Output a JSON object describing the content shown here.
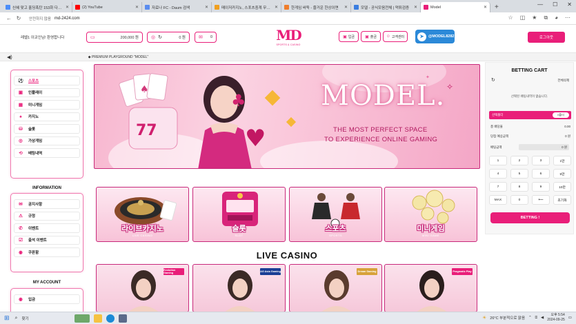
{
  "browser": {
    "tabs": [
      {
        "title": "신혜 맞고 홀딩폭탄 153화 다시보기",
        "color": "#4b8df8",
        "active": false
      },
      {
        "title": "(2) YouTube",
        "color": "#ff0000",
        "active": false
      },
      {
        "title": "자료나 FC - Daum 검색",
        "color": "#5b8def",
        "active": false
      },
      {
        "title": "메이저카지노, 스포츠중계 무료로",
        "color": "#f0a020",
        "active": false
      },
      {
        "title": "한게임 바둑 - 즐거운 한상이면",
        "color": "#ef7d2b",
        "active": false
      },
      {
        "title": "모델 - 공식모음전체 | 먹튀검증",
        "color": "#3a7de0",
        "active": false
      },
      {
        "title": "Model",
        "color": "#e91e79",
        "active": true
      }
    ],
    "new_tab": "+",
    "url_warning": "안전하지 않음",
    "url": "md-2424.com"
  },
  "header": {
    "welcome": "레벨1 이코인님! 환영합니다",
    "balance": "200,000 원",
    "points": "0 원",
    "messages": "0",
    "logo_text": "MD",
    "logo_sub": "SPORTS & CASINO",
    "deposit": "입금",
    "withdraw": "출금",
    "support": "고객센터",
    "telegram": "@MODEL8282",
    "login": "로그아웃"
  },
  "marquee": {
    "text": "◆ PREMIUM PLAYGROUND \"MODEL\""
  },
  "sidebar": {
    "main_items": [
      {
        "label": "스포츠",
        "icon": "soccer-ball-icon",
        "glyph": "⚽",
        "active": true
      },
      {
        "label": "인플레이",
        "icon": "play-icon",
        "glyph": "▣",
        "active": false
      },
      {
        "label": "미니게임",
        "icon": "gamepad-icon",
        "glyph": "▦",
        "active": false
      },
      {
        "label": "카지노",
        "icon": "cards-icon",
        "glyph": "♠",
        "active": false
      },
      {
        "label": "슬롯",
        "icon": "slot-icon",
        "glyph": "⛁",
        "active": false
      },
      {
        "label": "가상게임",
        "icon": "virtual-icon",
        "glyph": "◎",
        "active": false
      },
      {
        "label": "배팅내역",
        "icon": "history-icon",
        "glyph": "⟲",
        "active": false
      }
    ],
    "info_title": "INFORMATION",
    "info_items": [
      {
        "label": "공지사항",
        "icon": "megaphone-icon",
        "glyph": "✉"
      },
      {
        "label": "규정",
        "icon": "rules-icon",
        "glyph": "⚠"
      },
      {
        "label": "이벤트",
        "icon": "event-icon",
        "glyph": "✆"
      },
      {
        "label": "출석 이벤트",
        "icon": "calendar-icon",
        "glyph": "☑"
      },
      {
        "label": "쿠폰함",
        "icon": "coupon-icon",
        "glyph": "◉"
      }
    ],
    "account_title": "MY ACCOUNT",
    "account_items": [
      {
        "label": "입금",
        "icon": "deposit-icon",
        "glyph": "◉"
      }
    ]
  },
  "banner": {
    "title": "MODEL.",
    "line1": "THE MOST PERFECT SPACE",
    "line2": "TO EXPERIENCE ONLINE GAMING"
  },
  "categories": [
    {
      "ko": "라이브카지노",
      "en": "LIVE CASINO"
    },
    {
      "ko": "슬롯",
      "en": "SLOT"
    },
    {
      "ko": "스포츠",
      "en": "SPORTS"
    },
    {
      "ko": "미니게임",
      "en": "MINI GAME"
    }
  ],
  "live_section": {
    "title": "LIVE CASINO",
    "providers": [
      "Evolution Gaming",
      "AG Asia Gaming",
      "Dream Gaming",
      "Pragmatic Play"
    ]
  },
  "cart": {
    "title": "BETTING CART",
    "delete_all": "전체삭제",
    "empty_msg": "선택된 배팅내역이 없습니다.",
    "selected_label": "선택폴더",
    "reset": "0폴더",
    "total_odds_label": "총 배당율",
    "total_odds": "0.00",
    "expected_label": "당첨 예상금액",
    "expected": "0 원",
    "bet_amount_label": "배팅금액",
    "bet_amount": "0 원",
    "keys": [
      "1",
      "2",
      "3",
      "1만",
      "4",
      "5",
      "6",
      "5만",
      "7",
      "8",
      "9",
      "10만",
      "MAX",
      "0",
      "⟵",
      "초기화"
    ],
    "betting_button": "BETTING !"
  },
  "taskbar": {
    "search": "찾기",
    "weather": "26°C 부분적으로 맑음",
    "time": "오후 5:54",
    "date": "2024-09-25"
  }
}
